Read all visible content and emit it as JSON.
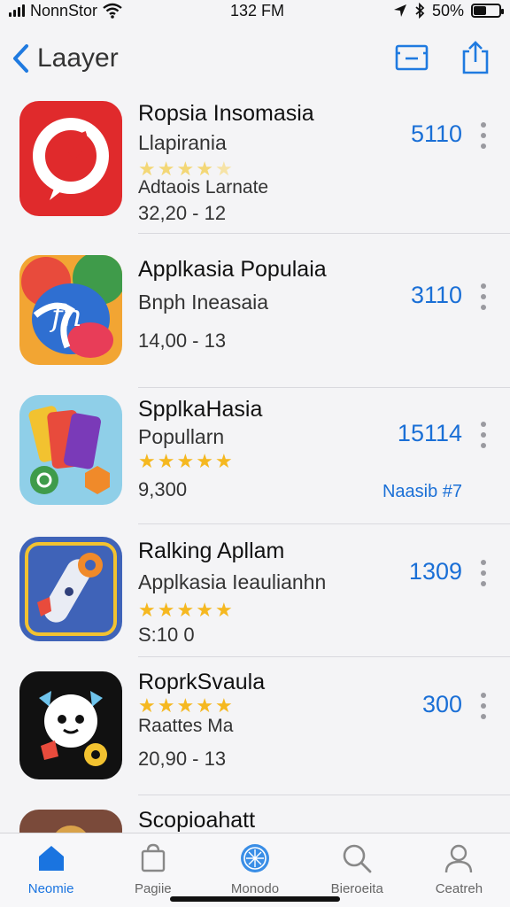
{
  "status_bar": {
    "carrier": "NonnStor",
    "time": "132 FM",
    "battery": "50%",
    "battery_level": 0.5,
    "icons": [
      "signal-icon",
      "wifi-icon",
      "location-icon",
      "bluetooth-icon",
      "battery-icon"
    ]
  },
  "nav": {
    "back_label": "Laayer",
    "actions": [
      "card-icon",
      "share-icon"
    ]
  },
  "apps": [
    {
      "name": "Ropsia Insomasia",
      "subtitle": "Llapirania",
      "rating": 4,
      "note": "Adtaois Larnate",
      "meta": "32,20 - 12",
      "price": "5110"
    },
    {
      "name": "Applkasia Populaia",
      "subtitle": "Bnph Ineasaia",
      "meta": "14,00 - 13",
      "price": "3110"
    },
    {
      "name": "SpplkaHasia",
      "subtitle": "Popullarn",
      "rating": 5,
      "meta": "9,300",
      "price": "15114",
      "rank": "Naasib #7"
    },
    {
      "name": "Ralking Apllam",
      "subtitle": "Applkasia Ieaulianhn",
      "rating": 5,
      "meta": "S:10 0",
      "price": "1309"
    },
    {
      "name": "RoprkSvaula",
      "rating": 5,
      "note": "Raattes Ma",
      "meta": "20,90 - 13",
      "price": "300"
    },
    {
      "name": "Scopioahatt"
    }
  ],
  "tabs": [
    {
      "label": "Neomie",
      "icon": "home-icon",
      "active": true
    },
    {
      "label": "Pagiie",
      "icon": "bag-icon",
      "active": false
    },
    {
      "label": "Monodo",
      "icon": "compass-icon",
      "active": false
    },
    {
      "label": "Bieroeita",
      "icon": "search-icon",
      "active": false
    },
    {
      "label": "Ceatreh",
      "icon": "profile-icon",
      "active": false
    }
  ],
  "colors": {
    "accent": "#1a6fd6",
    "star": "#f5b820",
    "background": "#f4f4f6"
  }
}
